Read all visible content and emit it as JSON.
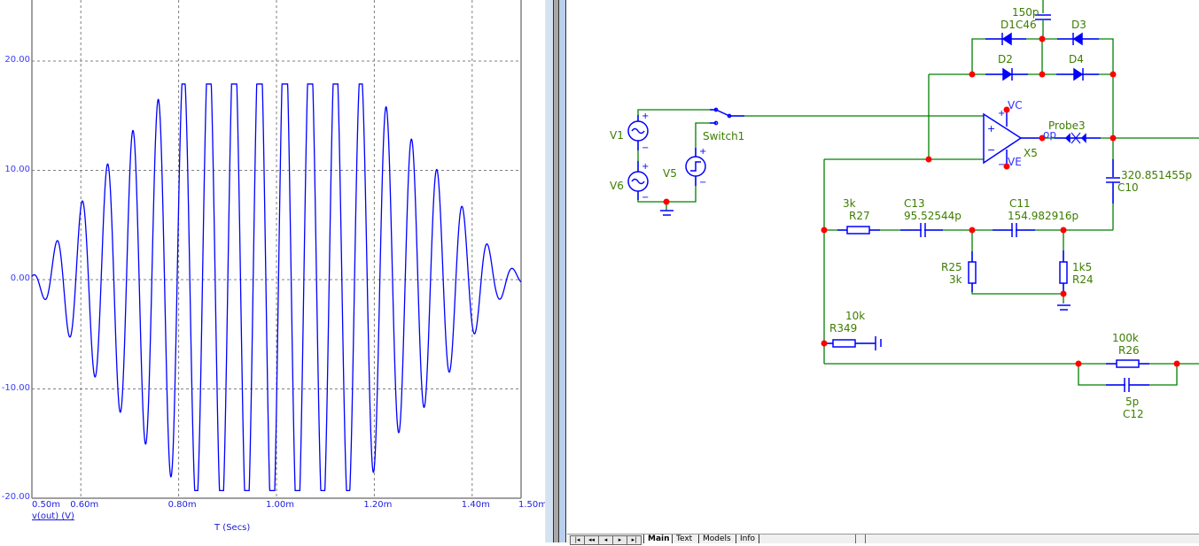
{
  "chart_data": {
    "type": "line",
    "title": "",
    "xlabel": "T (Secs)",
    "ylabel": "",
    "trace_label": "v(out) (V)",
    "xlim": [
      0.0005,
      0.0015
    ],
    "ylim": [
      -20,
      25
    ],
    "grid": true,
    "y_ticks": [
      20,
      10,
      0,
      -10,
      -20
    ],
    "y_tick_labels": [
      "20.00",
      "10.00",
      "0.00",
      "-10.00",
      "-20.00"
    ],
    "x_ticks": [
      0.0005,
      0.0006,
      0.0008,
      0.001,
      0.0012,
      0.0014,
      0.0015
    ],
    "x_tick_labels": [
      "0.50m",
      "0.60m",
      "0.80m",
      "1.00m",
      "1.20m",
      "1.40m",
      "1.50m"
    ],
    "series": [
      {
        "name": "v(out)",
        "color": "#0000ff",
        "signal": "amplitude-modulated sine, clipped",
        "period_s": 5.18e-05,
        "first_trough_s": 0.000525,
        "clip_high": 17.9,
        "clip_low": -19.3,
        "envelope": [
          [
            0.0005,
            0.3
          ],
          [
            0.000526,
            1.8
          ],
          [
            0.000552,
            3.6
          ],
          [
            0.000578,
            5.3
          ],
          [
            0.0006,
            7.0
          ],
          [
            0.00065,
            10.3
          ],
          [
            0.0007,
            13.3
          ],
          [
            0.00075,
            16.0
          ],
          [
            0.0008,
            19.0
          ],
          [
            0.00085,
            21.5
          ],
          [
            0.001,
            24.0
          ],
          [
            0.00115,
            21.0
          ],
          [
            0.0012,
            17.5
          ],
          [
            0.00125,
            14.0
          ],
          [
            0.0013,
            11.8
          ],
          [
            0.00135,
            8.7
          ],
          [
            0.0014,
            5.3
          ],
          [
            0.00145,
            2.0
          ],
          [
            0.0015,
            0.5
          ]
        ]
      }
    ]
  },
  "schematic": {
    "labels": {
      "c46_value": "150p",
      "d1": "D1",
      "c46": "C46",
      "d3": "D3",
      "d2": "D2",
      "d4": "D4",
      "vc": "VC",
      "ve": "VE",
      "x5": "X5",
      "op": "op",
      "probe3": "Probe3",
      "c10_value": "320.851455p",
      "c10": "C10",
      "v1": "V1",
      "v6": "V6",
      "v5": "V5",
      "switch1": "Switch1",
      "r27_value": "3k",
      "r27": "R27",
      "c13": "C13",
      "c13_value": "95.52544p",
      "c11": "C11",
      "c11_value": "154.982916p",
      "r25": "R25",
      "r25_value": "3k",
      "r24_value": "1k5",
      "r24": "R24",
      "r349_value": "10k",
      "r349": "R349",
      "r26_value": "100k",
      "r26": "R26",
      "c12_value": "5p",
      "c12": "C12"
    },
    "colors": {
      "wire": "#008000",
      "component": "#0000ff",
      "node": "#ff0000"
    }
  },
  "tabs": [
    "Main",
    "Text",
    "Models",
    "Info"
  ]
}
